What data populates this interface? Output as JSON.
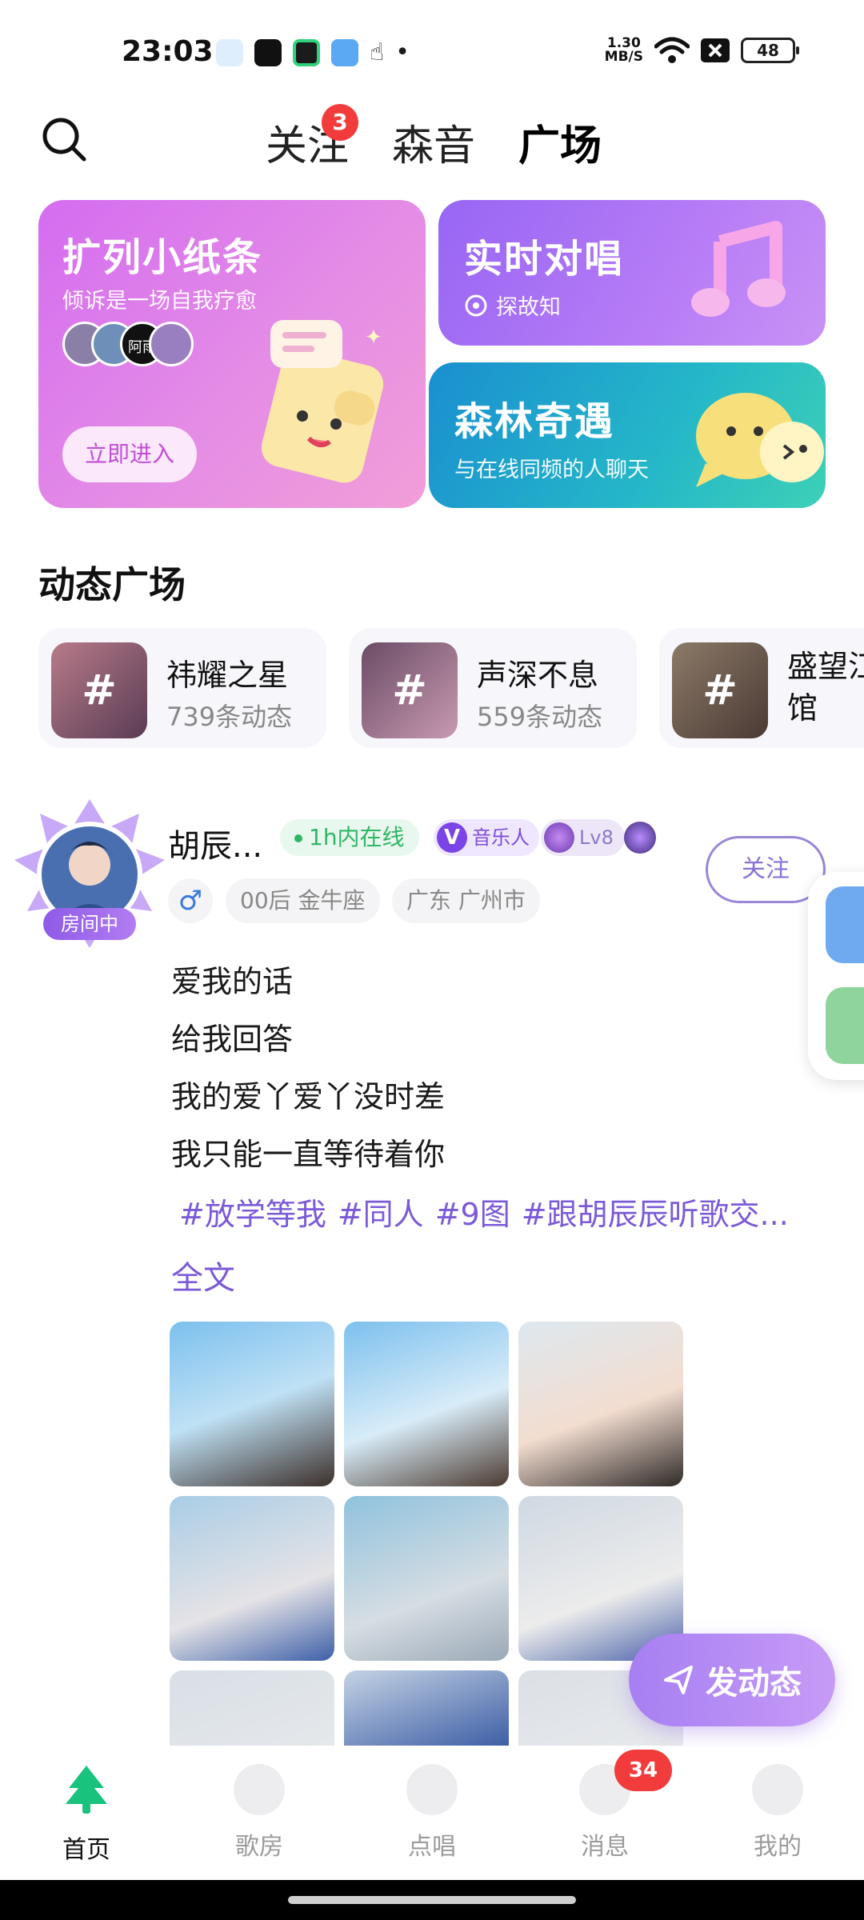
{
  "status_bar": {
    "time": "23:03",
    "net_speed_value": "1.30",
    "net_speed_unit": "MB/S",
    "battery": "48"
  },
  "header": {
    "tabs": [
      {
        "label": "关注",
        "badge": "3"
      },
      {
        "label": "森音"
      },
      {
        "label": "广场",
        "active": true
      }
    ]
  },
  "cards": {
    "note": {
      "title": "扩列小纸条",
      "subtitle": "倾诉是一场自我疗愈",
      "button": "立即进入",
      "avatar_text": "阿雨"
    },
    "duet": {
      "title": "实时对唱",
      "subtitle": "探故知"
    },
    "forest": {
      "title": "森林奇遇",
      "subtitle": "与在线同频的人聊天"
    }
  },
  "section": {
    "title": "动态广场"
  },
  "topics": [
    {
      "name": "祎耀之星",
      "count": "739条动态"
    },
    {
      "name": "声深不息",
      "count": "559条动态"
    },
    {
      "name": "盛望江\n馆",
      "count": ""
    }
  ],
  "post": {
    "room_badge": "房间中",
    "name": "胡辰...",
    "online": "1h内在线",
    "musician_badge": "音乐人",
    "level": "Lv8",
    "follow": "关注",
    "gender_symbol": "♂",
    "tags": [
      "00后 金牛座",
      "广东 广州市"
    ],
    "lines": [
      "爱我的话",
      "给我回答",
      "我的爱丫爱丫没时差",
      "我只能一直等待着你"
    ],
    "hashtags": [
      "#放学等我",
      "#同人",
      "#9图",
      "#跟胡辰辰听歌交..."
    ],
    "full_text": "全文"
  },
  "fab": {
    "label": "发动态"
  },
  "bottom_nav": [
    {
      "label": "首页",
      "active": true
    },
    {
      "label": "歌房"
    },
    {
      "label": "点唱"
    },
    {
      "label": "消息",
      "badge": "34"
    },
    {
      "label": "我的"
    }
  ],
  "colors": {
    "accent": "#7b5ad8",
    "tab_underline": "#2fd6a0",
    "badge_red": "#f23c3c",
    "online_green": "#2fb765"
  }
}
